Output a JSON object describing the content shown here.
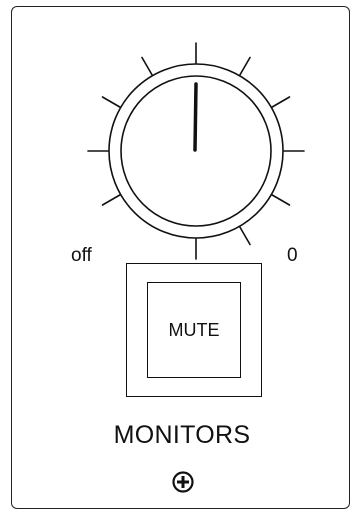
{
  "knob": {
    "label_min": "off",
    "label_max": "0",
    "color": "#111111"
  },
  "mute_button": {
    "label": "MUTE"
  },
  "section": {
    "title": "MONITORS",
    "icon": "plus-circle-icon"
  }
}
